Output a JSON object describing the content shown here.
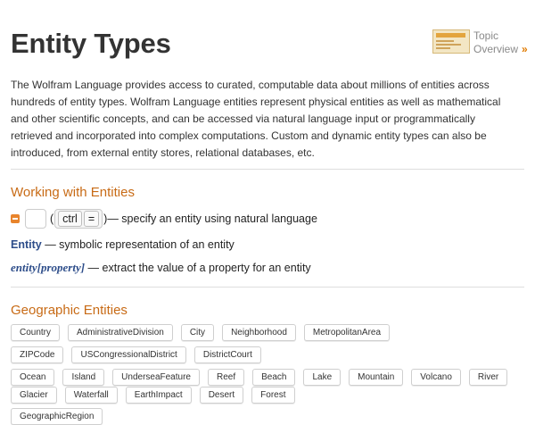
{
  "page_title": "Entity Types",
  "topic_overview": {
    "line1": "Topic",
    "line2": "Overview",
    "chevron": "»"
  },
  "intro": "The Wolfram Language provides access to curated, computable data about millions of entities across hundreds of entity types. Wolfram Language entities represent physical entities as well as mathematical and other scientific concepts, and can be accessed via natural language input or programmatically retrieved and incorporated into complex computations. Custom and dynamic entity types can also be introduced, from external entity stores, relational databases, etc.",
  "working": {
    "title": "Working with Entities",
    "ctrl_open": "(",
    "ctrl_key": "ctrl",
    "eq_key": "=",
    "ctrl_close": ")",
    "ctrl_desc": " — specify an entity using natural language",
    "entity_fn": "Entity",
    "entity_desc": " — symbolic representation of an entity",
    "prop_fn": "entity",
    "prop_open": "[",
    "prop_arg": "property",
    "prop_close": "]",
    "prop_desc": " — extract the value of a property for an entity"
  },
  "geographic": {
    "title": "Geographic Entities",
    "row1": [
      "Country",
      "AdministrativeDivision",
      "City",
      "Neighborhood",
      "MetropolitanArea"
    ],
    "row2": [
      "ZIPCode",
      "USCongressionalDistrict",
      "DistrictCourt"
    ],
    "row3": [
      "Ocean",
      "Island",
      "UnderseaFeature",
      "Reef",
      "Beach",
      "Lake",
      "Mountain",
      "Volcano",
      "River"
    ],
    "row4": [
      "Glacier",
      "Waterfall",
      "EarthImpact",
      "Desert",
      "Forest"
    ],
    "row5": [
      "GeographicRegion"
    ]
  },
  "colors": {
    "accent": "#c86b16",
    "link": "#2d4d8a",
    "icon": "#e8842c"
  }
}
